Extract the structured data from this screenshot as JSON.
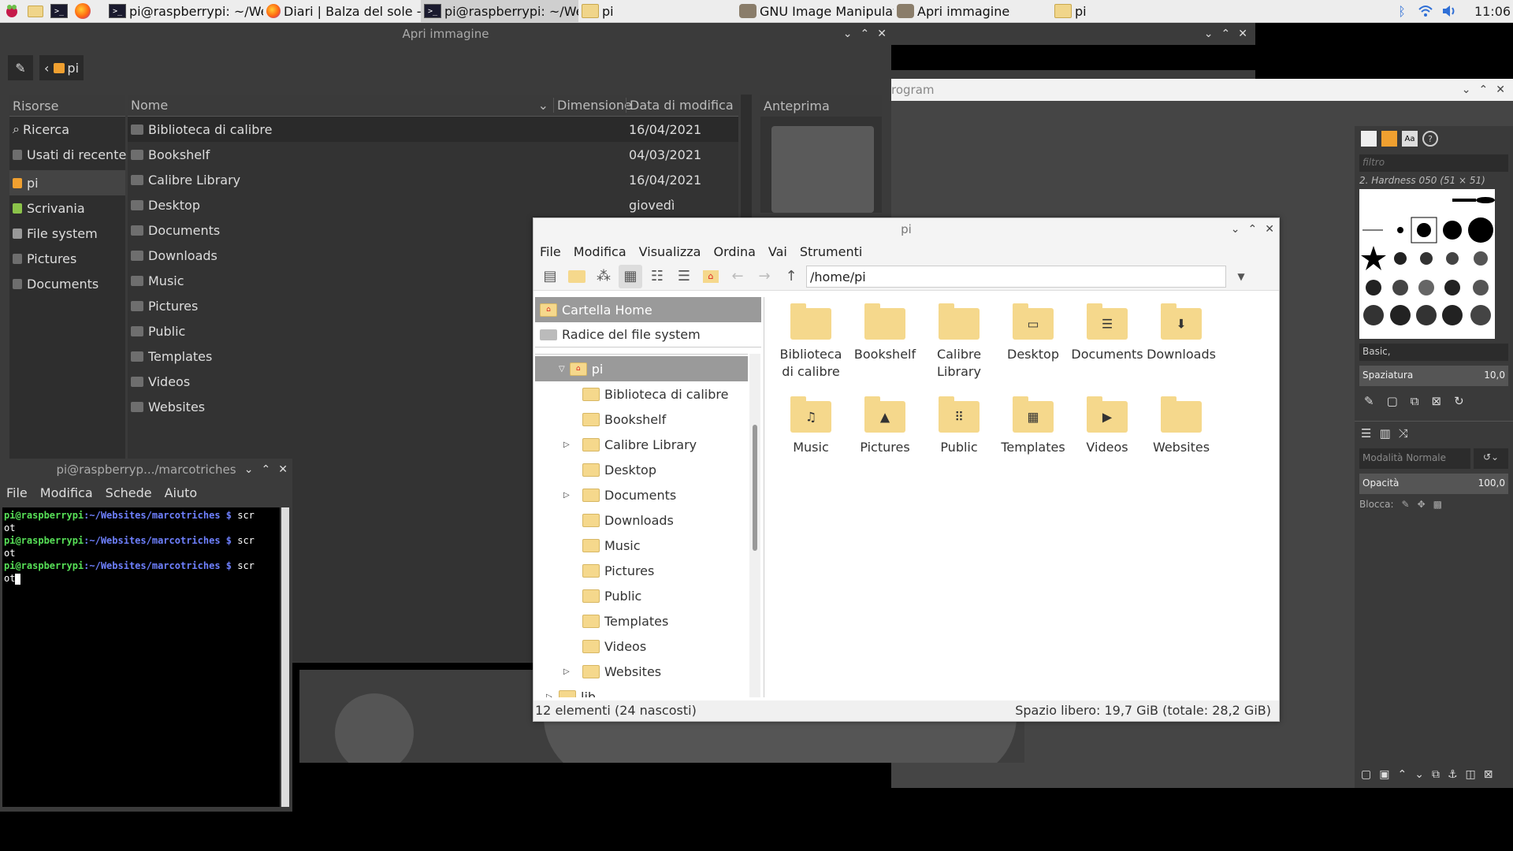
{
  "taskbar": {
    "tasks": [
      {
        "label": "pi@raspberrypi: ~/We…",
        "icon": "terminal-icon"
      },
      {
        "label": "Diari | Balza del sole - …",
        "icon": "firefox-icon"
      },
      {
        "label": "pi@raspberrypi: ~/We…",
        "icon": "terminal-icon"
      },
      {
        "label": "pi",
        "icon": "folder-icon"
      },
      {
        "label": "GNU Image Manipulati…",
        "icon": "gimp-icon"
      },
      {
        "label": "Apri immagine",
        "icon": "gimp-icon"
      },
      {
        "label": "pi",
        "icon": "folder-icon"
      }
    ],
    "clock": "11:06"
  },
  "open_dialog": {
    "title": "Apri immagine",
    "path_button": "pi",
    "places_header": "Risorse",
    "places": [
      "Ricerca",
      "Usati di recente",
      "pi",
      "Scrivania",
      "File system",
      "Pictures",
      "Documents"
    ],
    "columns": {
      "name": "Nome",
      "size": "Dimensione",
      "date": "Data di modifica"
    },
    "files": [
      {
        "name": "Biblioteca di calibre",
        "date": "16/04/2021"
      },
      {
        "name": "Bookshelf",
        "date": "04/03/2021"
      },
      {
        "name": "Calibre Library",
        "date": "16/04/2021"
      },
      {
        "name": "Desktop",
        "date": "giovedì"
      },
      {
        "name": "Documents",
        "date": ""
      },
      {
        "name": "Downloads",
        "date": ""
      },
      {
        "name": "Music",
        "date": ""
      },
      {
        "name": "Pictures",
        "date": ""
      },
      {
        "name": "Public",
        "date": ""
      },
      {
        "name": "Templates",
        "date": ""
      },
      {
        "name": "Videos",
        "date": ""
      },
      {
        "name": "Websites",
        "date": ""
      }
    ],
    "preview_header": "Anteprima"
  },
  "gimp": {
    "title_partial": "rogram",
    "filter_placeholder": "filtro",
    "brush_name": "2. Hardness 050 (51 × 51)",
    "brush_set": "Basic,",
    "spacing_label": "Spaziatura",
    "spacing_value": "10,0",
    "mode_label": "Modalità Normale",
    "opacity_label": "Opacità",
    "opacity_value": "100,0",
    "lock_label": "Blocca:"
  },
  "file_manager": {
    "title": "pi",
    "menu": [
      "File",
      "Modifica",
      "Visualizza",
      "Ordina",
      "Vai",
      "Strumenti"
    ],
    "path": "/home/pi",
    "places": [
      "Cartella Home",
      "Radice del file system"
    ],
    "tree_root": "pi",
    "tree": [
      "Biblioteca di calibre",
      "Bookshelf",
      "Calibre Library",
      "Desktop",
      "Documents",
      "Downloads",
      "Music",
      "Pictures",
      "Public",
      "Templates",
      "Videos",
      "Websites"
    ],
    "tree_next": "lib",
    "icons": [
      {
        "label": "Biblioteca di calibre",
        "emblem": ""
      },
      {
        "label": "Bookshelf",
        "emblem": ""
      },
      {
        "label": "Calibre Library",
        "emblem": ""
      },
      {
        "label": "Desktop",
        "emblem": "▭"
      },
      {
        "label": "Documents",
        "emblem": "☰"
      },
      {
        "label": "Downloads",
        "emblem": "⬇"
      },
      {
        "label": "Music",
        "emblem": "♫"
      },
      {
        "label": "Pictures",
        "emblem": "▲"
      },
      {
        "label": "Public",
        "emblem": "⠿"
      },
      {
        "label": "Templates",
        "emblem": "▦"
      },
      {
        "label": "Videos",
        "emblem": "▶"
      },
      {
        "label": "Websites",
        "emblem": ""
      }
    ],
    "status_left": "12 elementi (24 nascosti)",
    "status_right": "Spazio libero: 19,7 GiB (totale: 28,2 GiB)"
  },
  "terminal": {
    "title": "pi@raspberryp.../marcotriches",
    "menu": [
      "File",
      "Modifica",
      "Schede",
      "Aiuto"
    ],
    "user_host": "pi@raspberrypi",
    "cwd": ":~/Websites/marcotriches $",
    "cmd1": " scr",
    "cmd2": "ot"
  }
}
